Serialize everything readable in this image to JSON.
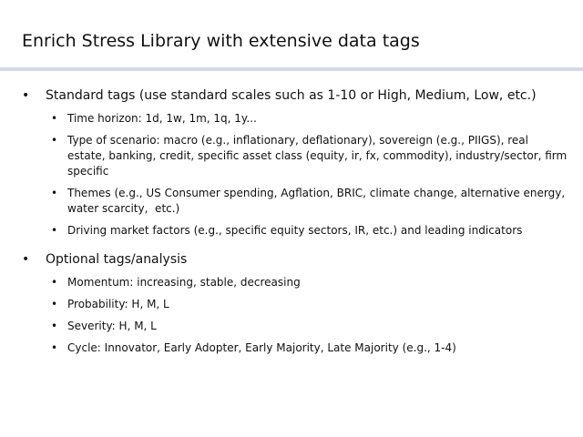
{
  "title": "Enrich Stress Library with extensive data tags",
  "sections": [
    {
      "heading": "Standard tags (use standard scales such as 1-10 or High, Medium, Low, etc.)",
      "items": [
        "Time horizon: 1d, 1w, 1m, 1q, 1y...",
        "Type of scenario: macro (e.g., inflationary, deflationary), sovereign (e.g., PIIGS), real estate, banking, credit, specific asset class (equity, ir, fx, commodity), industry/sector, firm specific",
        "Themes (e.g., US Consumer spending, Agflation, BRIC, climate change, alternative energy, water scarcity,  etc.)",
        "Driving market factors (e.g., specific equity sectors, IR, etc.) and leading indicators"
      ]
    },
    {
      "heading": "Optional tags/analysis",
      "items": [
        "Momentum: increasing, stable, decreasing",
        "Probability: H, M, L",
        "Severity: H, M, L",
        "Cycle: Innovator, Early Adopter, Early Majority, Late Majority (e.g., 1-4)"
      ]
    }
  ],
  "bullet": "•",
  "colors": {
    "rule": "#d6d8e6",
    "text": "#111111"
  }
}
